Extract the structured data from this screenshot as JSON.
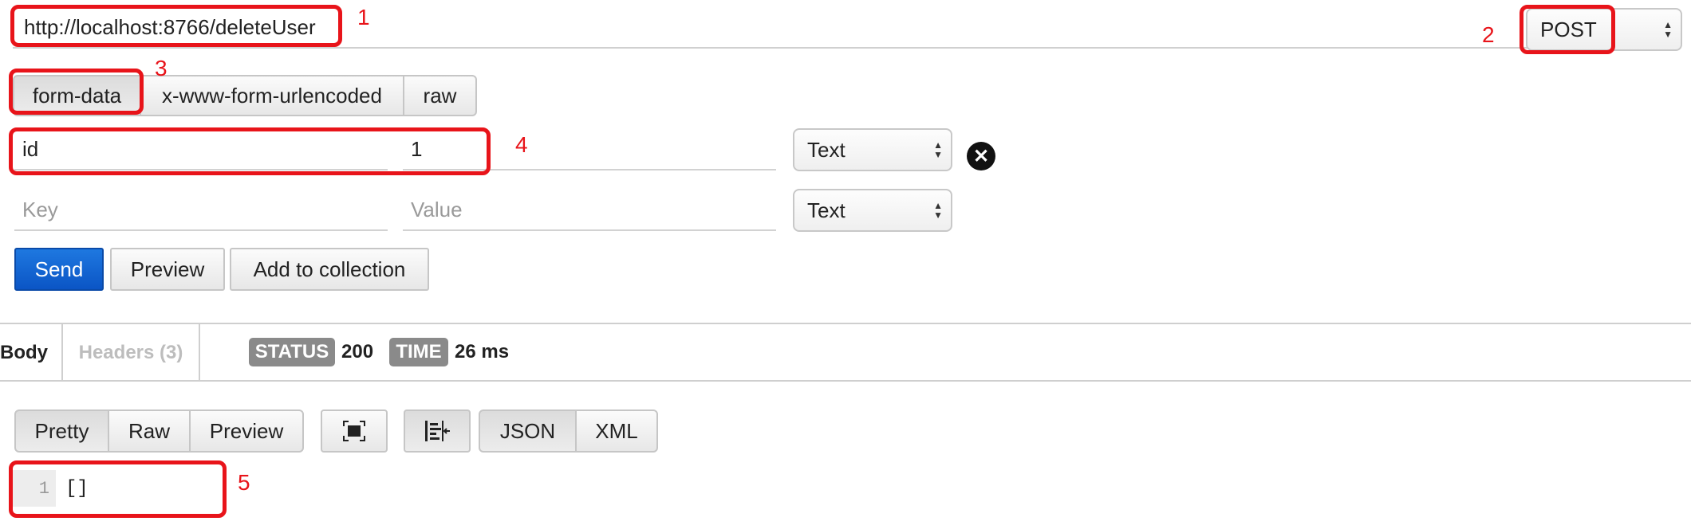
{
  "request": {
    "url": "http://localhost:8766/deleteUser",
    "method": "POST"
  },
  "body_modes": [
    "form-data",
    "x-www-form-urlencoded",
    "raw"
  ],
  "params": [
    {
      "key": "id",
      "value": "1",
      "type": "Text"
    },
    {
      "key_placeholder": "Key",
      "value_placeholder": "Value",
      "type": "Text"
    }
  ],
  "actions": {
    "send": "Send",
    "preview": "Preview",
    "add_to_collection": "Add to collection"
  },
  "response": {
    "tab_body": "Body",
    "tab_headers": "Headers (3)",
    "status_label": "STATUS",
    "status_value": "200",
    "time_label": "TIME",
    "time_value": "26 ms",
    "view_modes": [
      "Pretty",
      "Raw",
      "Preview"
    ],
    "formats": [
      "JSON",
      "XML"
    ],
    "line_number": "1",
    "content": "[]"
  },
  "annotations": [
    "1",
    "2",
    "3",
    "4",
    "5"
  ],
  "colors": {
    "highlight": "#e8141a",
    "send_button": "#0b55c5",
    "badge": "#8a8a8a"
  },
  "icons": {
    "remove_param": "x-circle-icon",
    "fullscreen": "fullscreen-icon",
    "wrap": "wrap-lines-icon"
  }
}
